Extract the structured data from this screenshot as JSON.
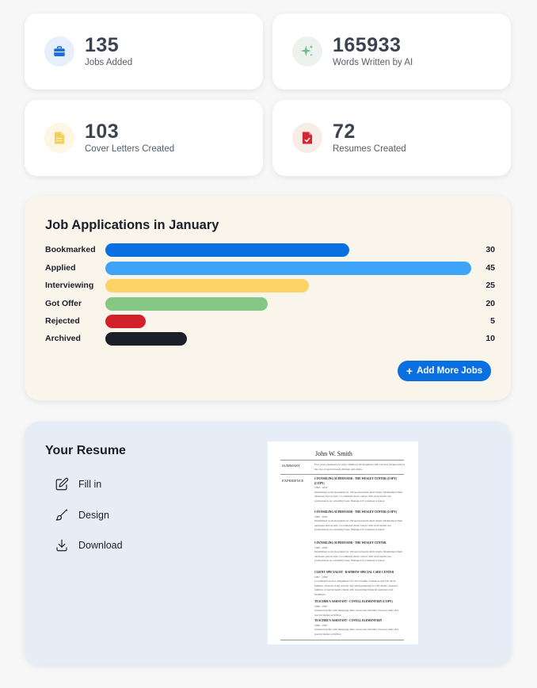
{
  "stats": [
    {
      "value": "135",
      "label": "Jobs Added",
      "icon": "briefcase-icon",
      "color": "#1d6fd8",
      "bg": "#e6effb"
    },
    {
      "value": "165933",
      "label": "Words Written by AI",
      "icon": "sparkles-icon",
      "color": "#6cbf8a",
      "bg": "#eef2ef"
    },
    {
      "value": "103",
      "label": "Cover Letters Created",
      "icon": "document-icon",
      "color": "#f5cf5c",
      "bg": "#fdf6e3"
    },
    {
      "value": "72",
      "label": "Resumes Created",
      "icon": "resume-check-icon",
      "color": "#d3262f",
      "bg": "#f7ece6"
    }
  ],
  "applications": {
    "title": "Job Applications in January",
    "add_button_label": "Add More Jobs",
    "rows": [
      {
        "label": "Bookmarked",
        "count": 30,
        "color": "#0a6fe0"
      },
      {
        "label": "Applied",
        "count": 45,
        "color": "#3fa4f8"
      },
      {
        "label": "Interviewing",
        "count": 25,
        "color": "#fdd267"
      },
      {
        "label": "Got Offer",
        "count": 20,
        "color": "#86c785"
      },
      {
        "label": "Rejected",
        "count": 5,
        "color": "#d3212b"
      },
      {
        "label": "Archived",
        "count": 10,
        "color": "#1b1f2a"
      }
    ]
  },
  "resume": {
    "title": "Your Resume",
    "actions": [
      {
        "label": "Fill in",
        "icon": "edit-icon"
      },
      {
        "label": "Design",
        "icon": "brush-icon"
      },
      {
        "label": "Download",
        "icon": "download-icon"
      }
    ],
    "preview": {
      "name": "John W. Smith",
      "summary_heading": "SUMMARY",
      "summary_text": "Five years experience in early childhood development with a diverse background in the care of special needs children and adults.",
      "experience_heading": "EXPERIENCE",
      "jobs": [
        {
          "title": "COUNSELING SUPERVISOR - THE WESLEY CENTER (COPY) (COPY)",
          "years": "1999 - 2002",
          "text": "Determined work placement for 150 special needs adult clients. Maintained client databases and records. Coordinated client contact with local health care professionals on a monthly basis. Managed 25 volunteer workers."
        },
        {
          "title": "COUNSELING SUPERVISOR - THE WESLEY CENTER (COPY)",
          "years": "1999 - 2002",
          "text": "Determined work placement for 150 special needs adult clients. Maintained client databases and records. Coordinated client contact with local health care professionals on a monthly basis. Managed 25 volunteer workers."
        },
        {
          "title": "COUNSELING SUPERVISOR - THE WESLEY CENTER",
          "years": "1999 - 2002",
          "text": "Determined work placement for 150 special needs adult clients. Maintained client databases and records. Coordinated client contact with local health care professionals on a monthly basis. Managed 25 volunteer workers."
        },
        {
          "title": "CLIENT SPECIALIST - RAINBOW SPECIAL CARE CENTER",
          "years": "1997 - 1999",
          "text": "Coordinated service assignments for 20 part-time counselors and 100 client families. Oversaw daily activity and outing planning for 100 clients. Assisted families of special needs clients with researching financial assistance and healthcare."
        },
        {
          "title": "TEACHER'S ASSISTANT - COVELL ELEMENTARY (COPY)",
          "years": "1996 - 1997",
          "text": "Assisted teacher with managing daily classroom activities. Oversaw daily and special student activities."
        },
        {
          "title": "TEACHER'S ASSISTANT - COVELL ELEMENTARY",
          "years": "1996 - 1997",
          "text": "Assisted teacher with managing daily classroom activities. Oversaw daily and special student activities."
        }
      ]
    }
  }
}
